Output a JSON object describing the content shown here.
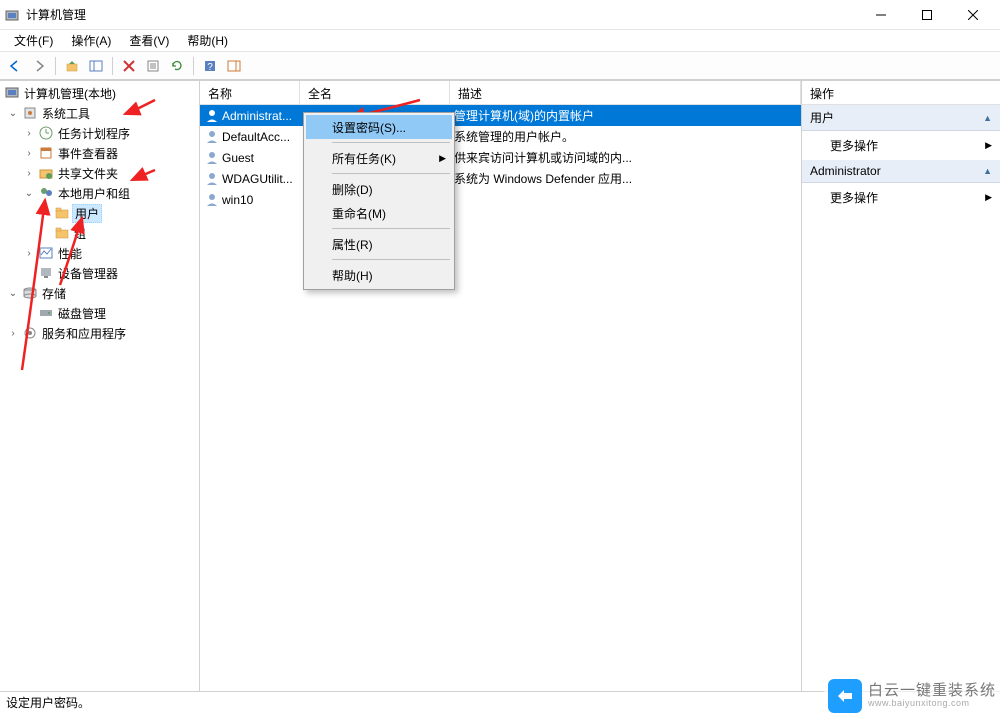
{
  "window": {
    "title": "计算机管理"
  },
  "menubar": [
    {
      "id": "file",
      "label": "文件(F)"
    },
    {
      "id": "action",
      "label": "操作(A)"
    },
    {
      "id": "view",
      "label": "查看(V)"
    },
    {
      "id": "help",
      "label": "帮助(H)"
    }
  ],
  "tree": {
    "root": "计算机管理(本地)",
    "system_tools": "系统工具",
    "task_scheduler": "任务计划程序",
    "event_viewer": "事件查看器",
    "shared_folders": "共享文件夹",
    "local_users": "本地用户和组",
    "users": "用户",
    "groups": "组",
    "performance": "性能",
    "device_manager": "设备管理器",
    "storage": "存储",
    "disk_management": "磁盘管理",
    "services_apps": "服务和应用程序"
  },
  "list": {
    "columns": {
      "name": "名称",
      "fullname": "全名",
      "description": "描述"
    },
    "rows": [
      {
        "name": "Administrat...",
        "full": "",
        "desc": "管理计算机(域)的内置帐户",
        "selected": true
      },
      {
        "name": "DefaultAcc...",
        "full": "",
        "desc": "系统管理的用户帐户。"
      },
      {
        "name": "Guest",
        "full": "",
        "desc": "供来宾访问计算机或访问域的内..."
      },
      {
        "name": "WDAGUtilit...",
        "full": "",
        "desc": "系统为 Windows Defender 应用..."
      },
      {
        "name": "win10",
        "full": "",
        "desc": ""
      }
    ]
  },
  "context_menu": {
    "set_password": "设置密码(S)...",
    "all_tasks": "所有任务(K)",
    "delete": "删除(D)",
    "rename": "重命名(M)",
    "properties": "属性(R)",
    "help": "帮助(H)"
  },
  "actions": {
    "title": "操作",
    "group1": "用户",
    "group1_more": "更多操作",
    "group2": "Administrator",
    "group2_more": "更多操作"
  },
  "statusbar": "设定用户密码。",
  "watermark": {
    "main": "白云一键重装系统",
    "sub": "www.baiyunxitong.com"
  }
}
